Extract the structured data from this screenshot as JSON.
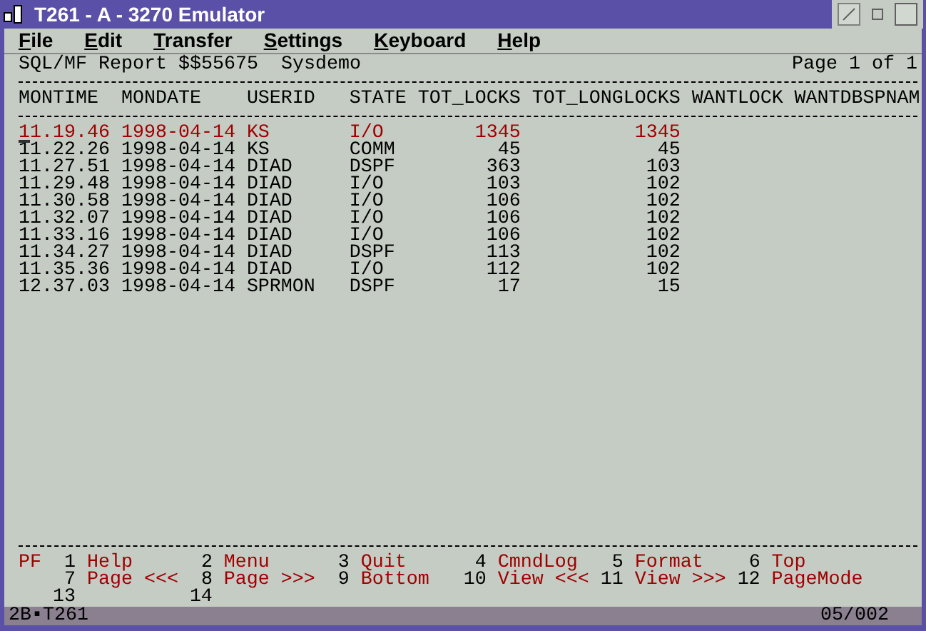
{
  "window": {
    "title": "T261 - A - 3270 Emulator"
  },
  "menu": [
    "File",
    "Edit",
    "Transfer",
    "Settings",
    "Keyboard",
    "Help"
  ],
  "report": {
    "title": "SQL/MF Report $$55675  Sysdemo",
    "page": "Page 1 of 1"
  },
  "table": {
    "columns": [
      "MONTIME",
      "MONDATE",
      "USERID",
      "STATE",
      "TOT_LOCKS",
      "TOT_LONGLOCKS",
      "WANTLOCK",
      "WANTDBSPNAM"
    ],
    "rows": [
      {
        "highlighted": true,
        "cells": [
          "11.19.46",
          "1998-04-14",
          "KS",
          "I/O",
          "1345",
          "1345"
        ]
      },
      {
        "highlighted": false,
        "cells": [
          "11.22.26",
          "1998-04-14",
          "KS",
          "COMM",
          "45",
          "45"
        ]
      },
      {
        "highlighted": false,
        "cells": [
          "11.27.51",
          "1998-04-14",
          "DIAD",
          "DSPF",
          "363",
          "103"
        ]
      },
      {
        "highlighted": false,
        "cells": [
          "11.29.48",
          "1998-04-14",
          "DIAD",
          "I/O",
          "103",
          "102"
        ]
      },
      {
        "highlighted": false,
        "cells": [
          "11.30.58",
          "1998-04-14",
          "DIAD",
          "I/O",
          "106",
          "102"
        ]
      },
      {
        "highlighted": false,
        "cells": [
          "11.32.07",
          "1998-04-14",
          "DIAD",
          "I/O",
          "106",
          "102"
        ]
      },
      {
        "highlighted": false,
        "cells": [
          "11.33.16",
          "1998-04-14",
          "DIAD",
          "I/O",
          "106",
          "102"
        ]
      },
      {
        "highlighted": false,
        "cells": [
          "11.34.27",
          "1998-04-14",
          "DIAD",
          "DSPF",
          "113",
          "102"
        ]
      },
      {
        "highlighted": false,
        "cells": [
          "11.35.36",
          "1998-04-14",
          "DIAD",
          "I/O",
          "112",
          "102"
        ]
      },
      {
        "highlighted": false,
        "cells": [
          "12.37.03",
          "1998-04-14",
          "SPRMON",
          "DSPF",
          "17",
          "15"
        ]
      }
    ]
  },
  "pf_label": "PF",
  "pf_keys": [
    [
      {
        "number": "1",
        "label": "Help"
      },
      {
        "number": "2",
        "label": "Menu"
      },
      {
        "number": "3",
        "label": "Quit"
      },
      {
        "number": "4",
        "label": "CmndLog"
      },
      {
        "number": "5",
        "label": "Format"
      },
      {
        "number": "6",
        "label": "Top"
      }
    ],
    [
      {
        "number": "7",
        "label": "Page <<<"
      },
      {
        "number": "8",
        "label": "Page >>>"
      },
      {
        "number": "9",
        "label": "Bottom"
      },
      {
        "number": "10",
        "label": "View <<<"
      },
      {
        "number": "11",
        "label": "View >>>"
      },
      {
        "number": "12",
        "label": "PageMode"
      }
    ],
    [
      {
        "number": "13"
      },
      {
        "number": "14"
      }
    ]
  ],
  "status_bar": {
    "session": "2B▪T261",
    "cursor_position": "05/002"
  }
}
